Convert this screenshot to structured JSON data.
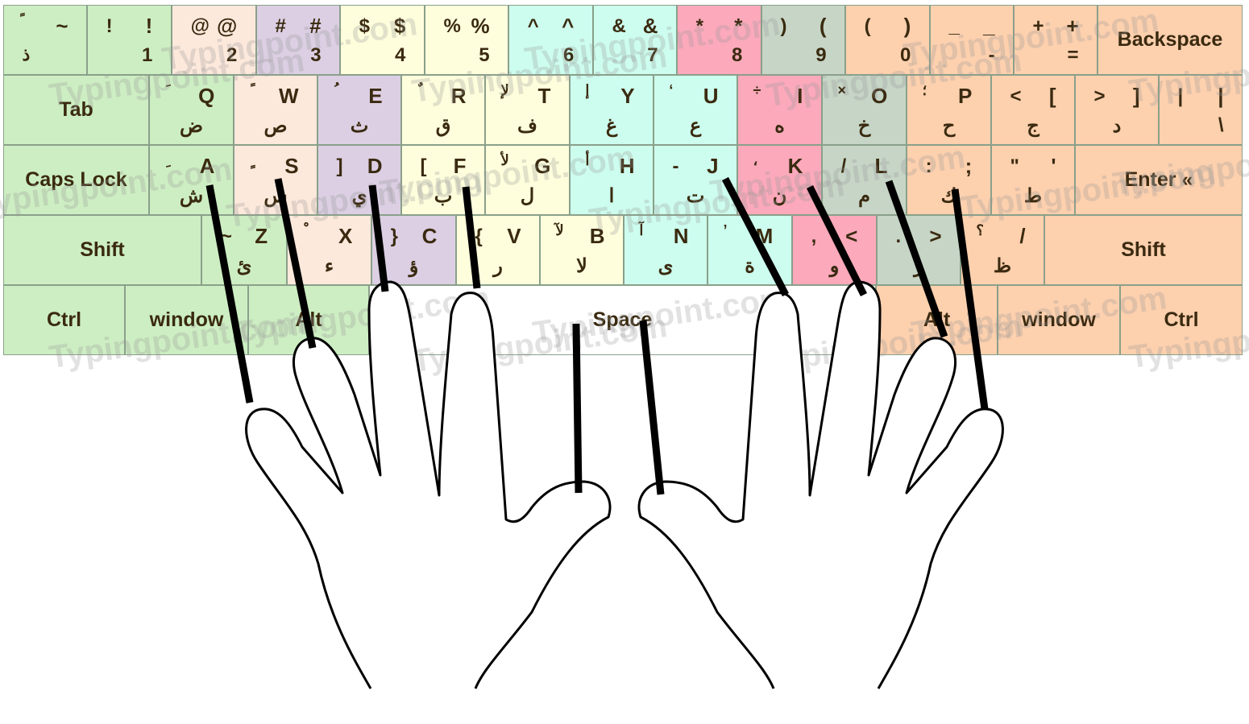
{
  "colors": {
    "green": "#cdeec3",
    "peach": "#fde9dc",
    "purple": "#dccfe3",
    "yellow": "#fefedd",
    "cyan": "#cdfdee",
    "pink": "#fba9bb",
    "gray": "#c6d5c6",
    "orange": "#fdd0ae",
    "space": "#ffffff"
  },
  "watermark": "Typingpoint.com",
  "rows": [
    [
      {
        "tla": "ً",
        "tr": "~",
        "bl": "ذ",
        "c": "green"
      },
      {
        "tl": "!",
        "tr": "!",
        "b": "1",
        "c": "green"
      },
      {
        "tl": "@",
        "tr": "@",
        "b": "2",
        "c": "peach"
      },
      {
        "tl": "#",
        "tr": "#",
        "b": "3",
        "c": "purple"
      },
      {
        "tl": "$",
        "tr": "$",
        "b": "4",
        "c": "yellow"
      },
      {
        "tl": "%",
        "tr": "%",
        "b": "5",
        "c": "yellow"
      },
      {
        "tl": "^",
        "tr": "^",
        "b": "6",
        "c": "cyan"
      },
      {
        "tl": "&",
        "tr": "&",
        "b": "7",
        "c": "cyan"
      },
      {
        "tl": "*",
        "tr": "*",
        "b": "8",
        "c": "pink"
      },
      {
        "tl": ")",
        "tr": "(",
        "b": "9",
        "c": "gray"
      },
      {
        "tl": "(",
        "tr": ")",
        "b": "0",
        "c": "orange"
      },
      {
        "tl": "_",
        "tr": "_",
        "b": "-",
        "c": "orange"
      },
      {
        "tl": "+",
        "tr": "+",
        "b": "=",
        "c": "orange"
      },
      {
        "big": "Backspace",
        "c": "orange"
      }
    ],
    [
      {
        "big": "Tab",
        "c": "green"
      },
      {
        "tla": "َ",
        "tr": "Q",
        "ba": "ض",
        "c": "green"
      },
      {
        "tla": "ً",
        "tr": "W",
        "ba": "ص",
        "c": "peach"
      },
      {
        "tla": "ُ",
        "tr": "E",
        "ba": "ث",
        "c": "purple"
      },
      {
        "tla": "ٌ",
        "tr": "R",
        "ba": "ق",
        "c": "yellow"
      },
      {
        "tla": "لإ",
        "tr": "T",
        "ba": "ف",
        "c": "yellow"
      },
      {
        "tla": "إ",
        "tr": "Y",
        "ba": "غ",
        "c": "cyan"
      },
      {
        "tla": "‘",
        "tr": "U",
        "ba": "ع",
        "c": "cyan"
      },
      {
        "tla": "÷",
        "tr": "I",
        "ba": "ه",
        "c": "pink"
      },
      {
        "tla": "×",
        "tr": "O",
        "ba": "خ",
        "c": "gray"
      },
      {
        "tla": "؛",
        "tr": "P",
        "ba": "ح",
        "c": "orange"
      },
      {
        "tl": "<",
        "tr": "[",
        "ba": "ج",
        "c": "orange"
      },
      {
        "tl": ">",
        "tr": "]",
        "ba": "د",
        "c": "orange"
      },
      {
        "tl": "|",
        "tr": "|",
        "b": "\\",
        "c": "orange"
      }
    ],
    [
      {
        "big": "Caps Lock",
        "c": "green"
      },
      {
        "tla": "ِ",
        "tr": "A",
        "ba": "ش",
        "c": "green"
      },
      {
        "tla": "ٍ",
        "tr": "S",
        "ba": "س",
        "c": "peach"
      },
      {
        "tl": "]",
        "tr": "D",
        "ba": "ي",
        "c": "purple"
      },
      {
        "tl": "[",
        "tr": "F",
        "ba": "ب",
        "c": "yellow"
      },
      {
        "tla": "لأ",
        "tr": "G",
        "ba": "ل",
        "c": "yellow"
      },
      {
        "tla": "أ",
        "tr": "H",
        "ba": "ا",
        "c": "cyan"
      },
      {
        "tl": "-",
        "tr": "J",
        "ba": "ت",
        "c": "cyan"
      },
      {
        "tla": "،",
        "tr": "K",
        "ba": "ن",
        "c": "pink"
      },
      {
        "tl": "/",
        "tr": "L",
        "ba": "م",
        "c": "gray"
      },
      {
        "tl": ":",
        "tr": ";",
        "ba": "ك",
        "c": "orange"
      },
      {
        "tl": "\"",
        "tr": "'",
        "ba": "ط",
        "c": "orange"
      },
      {
        "big": "Enter «",
        "c": "orange"
      }
    ],
    [
      {
        "big": "Shift",
        "c": "green"
      },
      {
        "tl": "~",
        "tr": "Z",
        "ba": "ئ",
        "c": "green"
      },
      {
        "tla": "ْ",
        "tr": "X",
        "ba": "ء",
        "c": "peach"
      },
      {
        "tl": "}",
        "tr": "C",
        "ba": "ؤ",
        "c": "purple"
      },
      {
        "tl": "{",
        "tr": "V",
        "ba": "ر",
        "c": "yellow"
      },
      {
        "tla": "لآ",
        "tr": "B",
        "ba": "لا",
        "c": "yellow"
      },
      {
        "tla": "آ",
        "tr": "N",
        "ba": "ى",
        "c": "cyan"
      },
      {
        "tla": "’",
        "tr": "M",
        "ba": "ة",
        "c": "cyan"
      },
      {
        "tl": ",",
        "tr": "<",
        "ba": "و",
        "c": "pink"
      },
      {
        "tl": ".",
        "tr": ">",
        "ba": "ز",
        "c": "gray"
      },
      {
        "tla": "؟",
        "tr": "/",
        "ba": "ظ",
        "c": "orange"
      },
      {
        "big": "Shift",
        "c": "orange"
      }
    ],
    [
      {
        "big": "Ctrl",
        "c": "green"
      },
      {
        "big": "window",
        "c": "green"
      },
      {
        "big": "Alt",
        "c": "green"
      },
      {
        "big": "Space",
        "c": "space"
      },
      {
        "big": "Alt",
        "c": "orange"
      },
      {
        "big": "window",
        "c": "orange"
      },
      {
        "big": "Ctrl",
        "c": "orange"
      }
    ]
  ]
}
